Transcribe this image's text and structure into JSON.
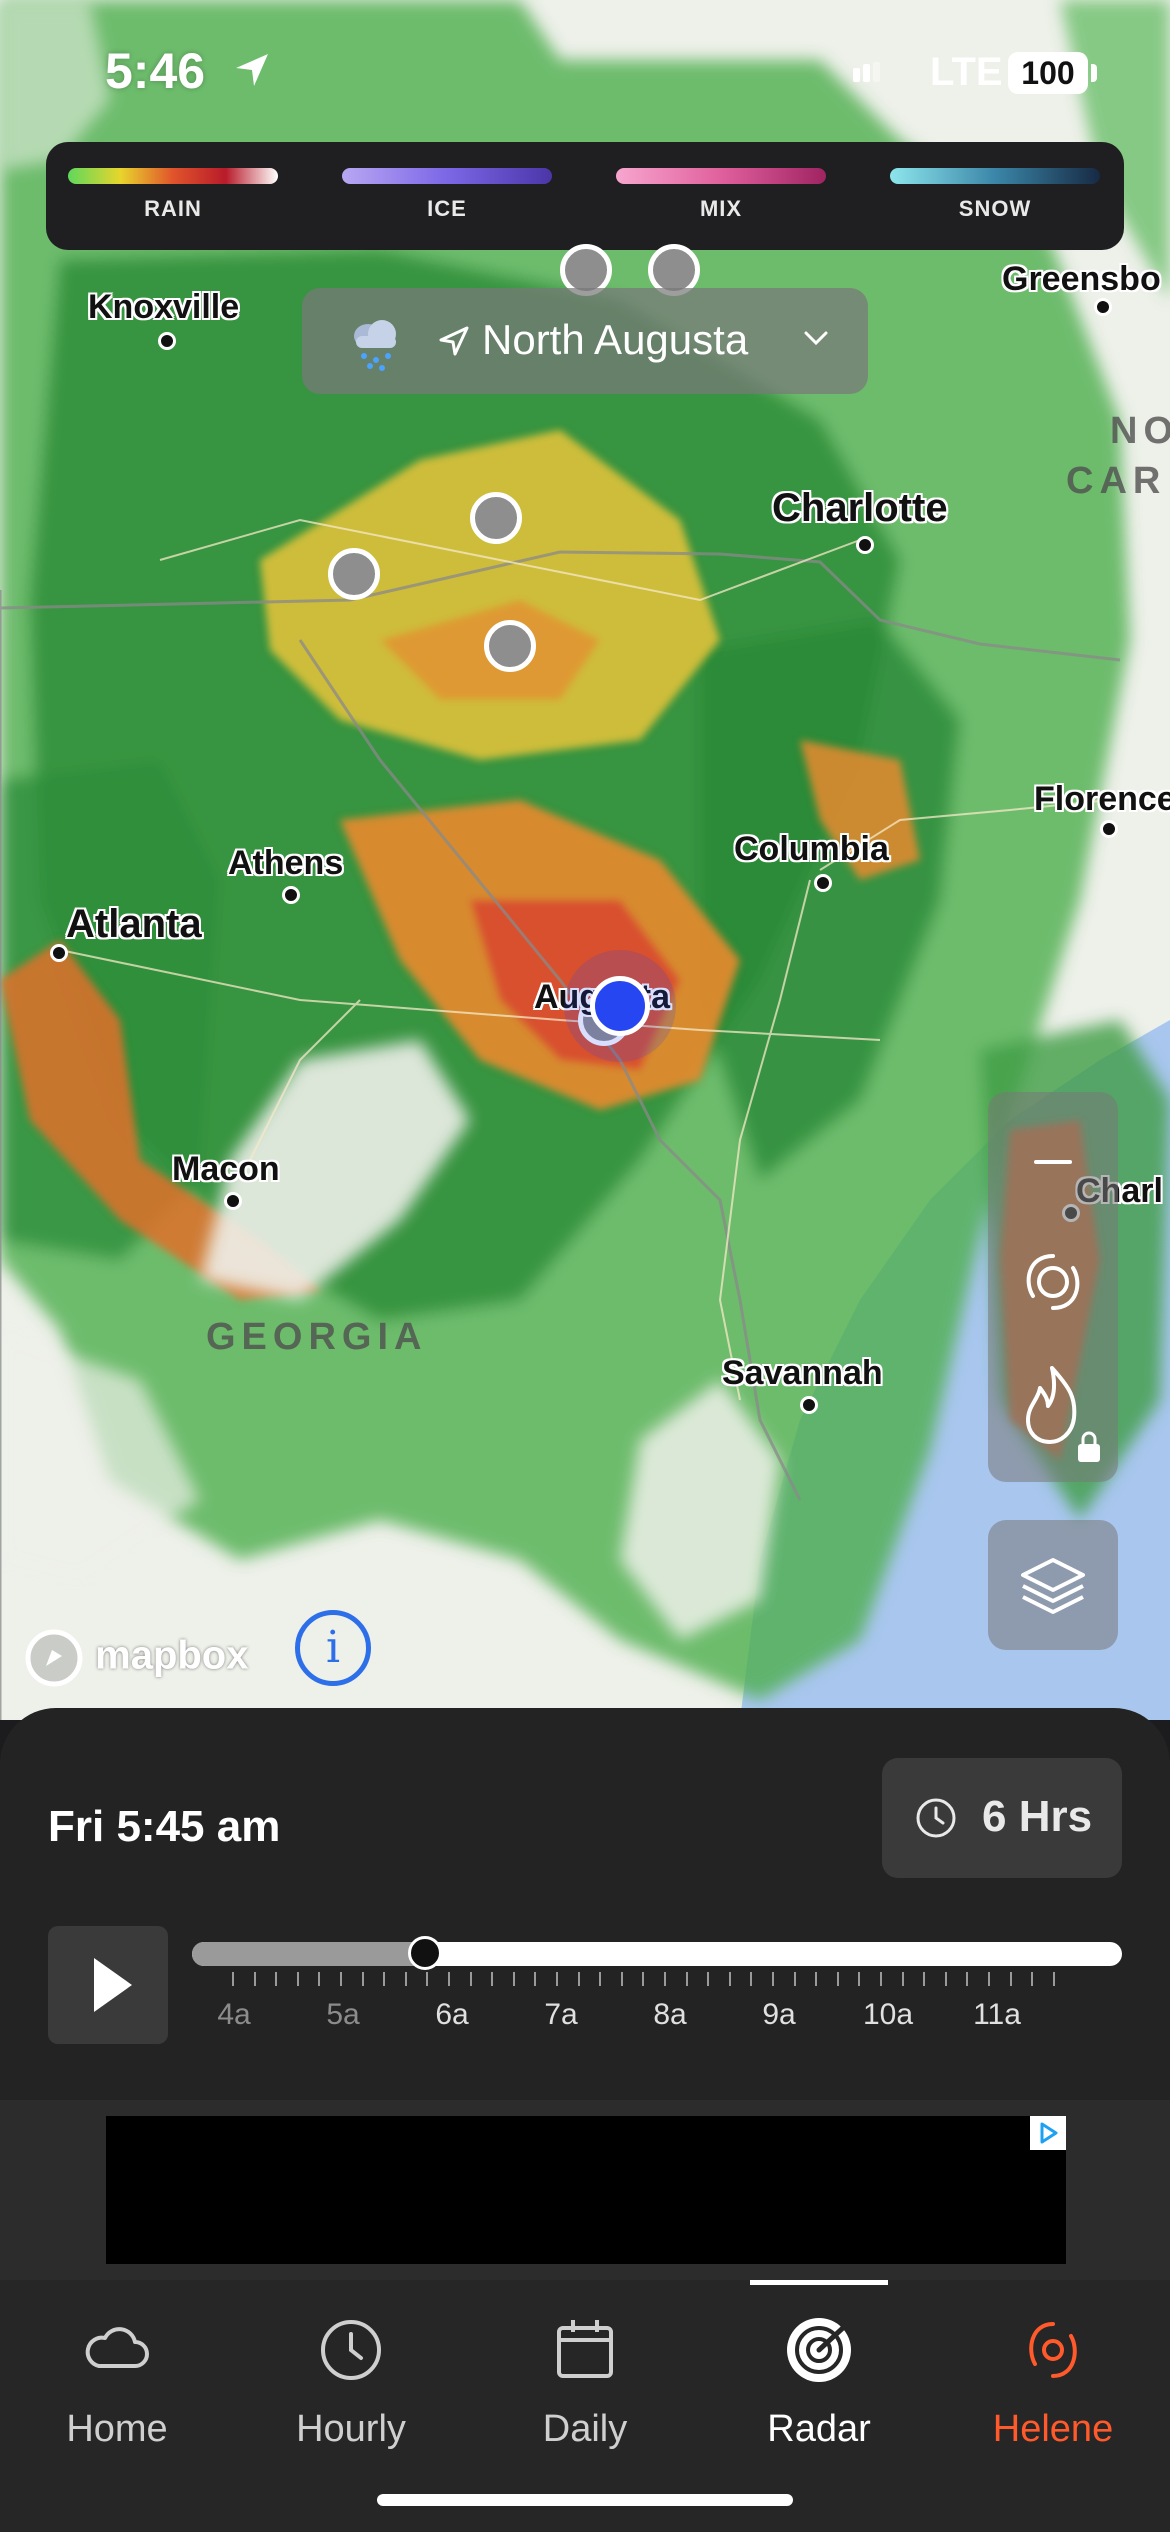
{
  "status_bar": {
    "time": "5:46",
    "network": "LTE",
    "battery": "100"
  },
  "legend": [
    {
      "label": "RAIN",
      "gradient": [
        "#5fd85c",
        "#e8d52c",
        "#e0542b",
        "#b81b2a",
        "#ffffff"
      ]
    },
    {
      "label": "ICE",
      "gradient": [
        "#b8a7f2",
        "#7c67e6",
        "#4b36a8"
      ]
    },
    {
      "label": "MIX",
      "gradient": [
        "#f7a6cf",
        "#e0609d",
        "#a02462"
      ]
    },
    {
      "label": "SNOW",
      "gradient": [
        "#8de6ec",
        "#3b86a8",
        "#172a44"
      ]
    }
  ],
  "location": {
    "name": "North Augusta"
  },
  "map": {
    "cities": [
      {
        "name": "Knoxville"
      },
      {
        "name": "Greensbo"
      },
      {
        "name": "Charlotte"
      },
      {
        "name": "Florence"
      },
      {
        "name": "Athens"
      },
      {
        "name": "Columbia"
      },
      {
        "name": "Atlanta"
      },
      {
        "name": "Augusta"
      },
      {
        "name": "Macon"
      },
      {
        "name": "Charl"
      },
      {
        "name": "Savannah"
      }
    ],
    "states": [
      "GEORGIA",
      "NO",
      "CAR"
    ],
    "attribution": "mapbox"
  },
  "timeline": {
    "timestamp": "Fri 5:45 am",
    "range_label": "6 Hrs",
    "progress": 0.25,
    "hours": [
      "4a",
      "5a",
      "6a",
      "7a",
      "8a",
      "9a",
      "10a",
      "11a"
    ],
    "past_hours": 2
  },
  "tabs": [
    {
      "label": "Home",
      "icon": "cloud-icon"
    },
    {
      "label": "Hourly",
      "icon": "clock-icon"
    },
    {
      "label": "Daily",
      "icon": "calendar-icon"
    },
    {
      "label": "Radar",
      "icon": "radar-icon"
    },
    {
      "label": "Helene",
      "icon": "hurricane-icon"
    }
  ],
  "colors": {
    "accent_storm": "#ff5a2b",
    "user_location": "#2646f2",
    "info": "#2d6fe8"
  }
}
